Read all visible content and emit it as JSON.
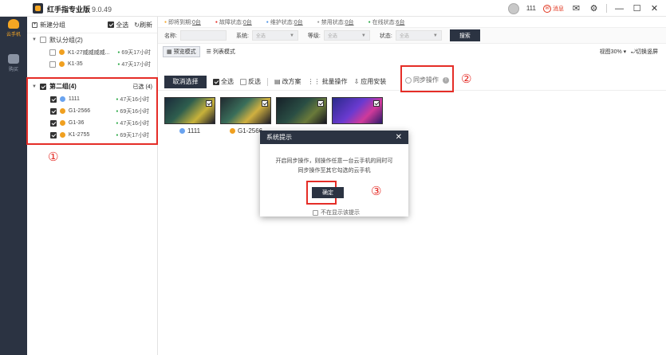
{
  "app": {
    "title": "红手指专业版",
    "version": "9.0.49"
  },
  "user": {
    "name": "111",
    "message_label": "消息"
  },
  "nav": {
    "items": [
      {
        "label": "云手机"
      },
      {
        "label": "购买"
      }
    ]
  },
  "groups": {
    "new_group_label": "新建分组",
    "select_all_label": "全选",
    "refresh_label": "刷新",
    "default_group": {
      "title": "默认分组(2)",
      "devices": [
        {
          "name": "K1-27威威威威...",
          "time": "69天17小时"
        },
        {
          "name": "K1-35",
          "time": "47天17小时"
        }
      ]
    },
    "group2": {
      "title": "第二组(4)",
      "select_label": "已选 (4)",
      "devices": [
        {
          "name": "1111",
          "time": "47天16小时"
        },
        {
          "name": "G1-2566",
          "time": "69天16小时"
        },
        {
          "name": "G1-36",
          "time": "47天16小时"
        },
        {
          "name": "K1-2755",
          "time": "69天17小时"
        }
      ]
    }
  },
  "status_strip": [
    {
      "label": "即将到期:",
      "value": "0台"
    },
    {
      "label": "故障状态:",
      "value": "0台"
    },
    {
      "label": "维护状态:",
      "value": "0台"
    },
    {
      "label": "禁用状态:",
      "value": "0台"
    },
    {
      "label": "在线状态:",
      "value": "6台"
    }
  ],
  "filter": {
    "name_label": "名称:",
    "system_label": "系统:",
    "level_label": "等级:",
    "state_label": "状态:",
    "all_option": "全选",
    "search_label": "搜索"
  },
  "view": {
    "preview_label": "预览模式",
    "list_label": "列表模式",
    "zoom_label": "视图30%",
    "switch_label": "切换竖屏"
  },
  "actions": {
    "cancel_select": "取消选择",
    "select_all": "全选",
    "invert": "反选",
    "plan": "改方案",
    "batch": "批量操作",
    "install": "应用安装",
    "sync": "同步操作"
  },
  "thumbs": [
    {
      "name": "1111"
    },
    {
      "name": "G1-2566"
    },
    {
      "name": ""
    },
    {
      "name": ""
    }
  ],
  "dialog": {
    "title": "系统提示",
    "line1": "开启同步操作，则操作任意一台云手机的同时可",
    "line2": "同步操作至其它勾选的云手机",
    "confirm": "确定",
    "dont_show": "不在显示该提示"
  },
  "annotations": {
    "one": "①",
    "two": "②",
    "three": "③"
  },
  "colors": {
    "accent": "#f5a623",
    "dark": "#2b3342",
    "annotation_red": "#e52d27",
    "online_green": "#2aa845"
  }
}
